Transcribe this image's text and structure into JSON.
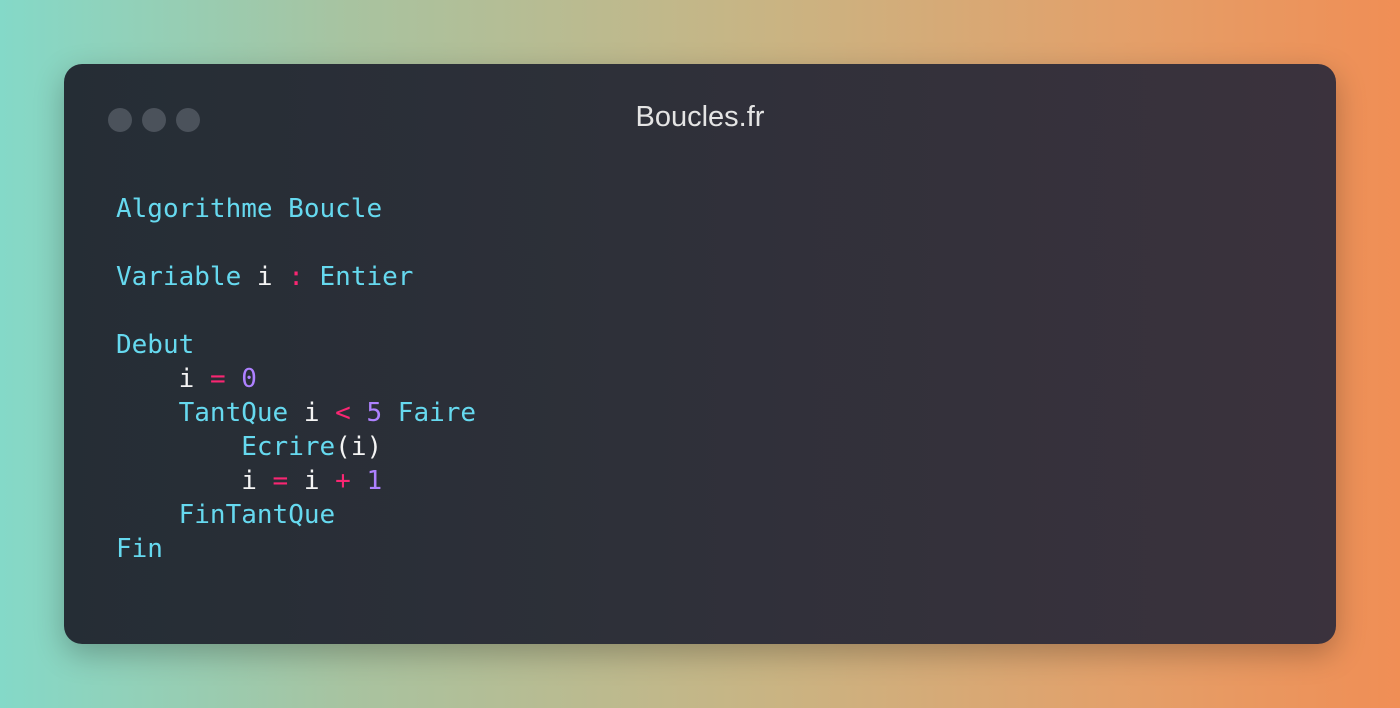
{
  "window": {
    "title": "Boucles.fr"
  },
  "colors": {
    "keyword": "#66d9ef",
    "identifier": "#f4f4f4",
    "operator": "#f92672",
    "number": "#ae81ff",
    "window_dot": "#4b525b"
  },
  "code": {
    "lines": [
      {
        "indent": "",
        "tokens": [
          {
            "t": "Algorithme Boucle",
            "c": "kw"
          }
        ]
      },
      {
        "indent": "",
        "tokens": []
      },
      {
        "indent": "",
        "tokens": [
          {
            "t": "Variable",
            "c": "kw"
          },
          {
            "t": " ",
            "c": "id"
          },
          {
            "t": "i",
            "c": "id"
          },
          {
            "t": " ",
            "c": "id"
          },
          {
            "t": ":",
            "c": "op"
          },
          {
            "t": " ",
            "c": "id"
          },
          {
            "t": "Entier",
            "c": "kw"
          }
        ]
      },
      {
        "indent": "",
        "tokens": []
      },
      {
        "indent": "",
        "tokens": [
          {
            "t": "Debut",
            "c": "kw"
          }
        ]
      },
      {
        "indent": "    ",
        "tokens": [
          {
            "t": "i",
            "c": "id"
          },
          {
            "t": " ",
            "c": "id"
          },
          {
            "t": "=",
            "c": "op"
          },
          {
            "t": " ",
            "c": "id"
          },
          {
            "t": "0",
            "c": "num"
          }
        ]
      },
      {
        "indent": "    ",
        "tokens": [
          {
            "t": "TantQue",
            "c": "kw"
          },
          {
            "t": " ",
            "c": "id"
          },
          {
            "t": "i",
            "c": "id"
          },
          {
            "t": " ",
            "c": "id"
          },
          {
            "t": "<",
            "c": "op"
          },
          {
            "t": " ",
            "c": "id"
          },
          {
            "t": "5",
            "c": "num"
          },
          {
            "t": " ",
            "c": "id"
          },
          {
            "t": "Faire",
            "c": "kw"
          }
        ]
      },
      {
        "indent": "        ",
        "tokens": [
          {
            "t": "Ecrire",
            "c": "kw"
          },
          {
            "t": "(",
            "c": "pn"
          },
          {
            "t": "i",
            "c": "id"
          },
          {
            "t": ")",
            "c": "pn"
          }
        ]
      },
      {
        "indent": "        ",
        "tokens": [
          {
            "t": "i",
            "c": "id"
          },
          {
            "t": " ",
            "c": "id"
          },
          {
            "t": "=",
            "c": "op"
          },
          {
            "t": " ",
            "c": "id"
          },
          {
            "t": "i",
            "c": "id"
          },
          {
            "t": " ",
            "c": "id"
          },
          {
            "t": "+",
            "c": "op"
          },
          {
            "t": " ",
            "c": "id"
          },
          {
            "t": "1",
            "c": "num"
          }
        ]
      },
      {
        "indent": "    ",
        "tokens": [
          {
            "t": "FinTantQue",
            "c": "kw"
          }
        ]
      },
      {
        "indent": "",
        "tokens": [
          {
            "t": "Fin",
            "c": "kw"
          }
        ]
      }
    ]
  }
}
